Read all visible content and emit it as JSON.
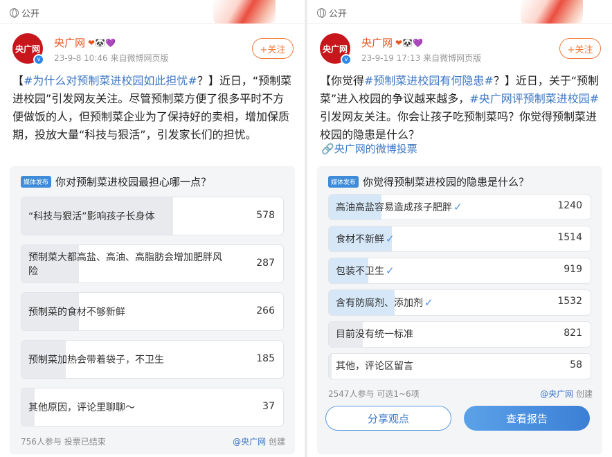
{
  "left": {
    "visibility": "公开",
    "account": "央广网",
    "time": "23-9-8 10:46",
    "source": "来自微博网页版",
    "follow": "+关注",
    "avatar": "央广网",
    "post_tag": "#为什么对预制菜进校园如此担忧#",
    "post_pre": "【",
    "post_text": "？】近日，“预制菜进校园”引发网友关注。尽管预制菜方便了很多平时不方便做饭的人，但预制菜企业为了保持好的卖相，增加保质期，投放大量“科技与狠活”，引发家长们的担忧。",
    "poll": {
      "badge": "媒体发布",
      "question": "你对预制菜进校园最担心哪一点？",
      "options": [
        {
          "label": "“科技与狠活”影响孩子长身体",
          "count": 578
        },
        {
          "label": "预制菜大都高盐、高油、高脂肪会增加肥胖风险",
          "count": 287
        },
        {
          "label": "预制菜的食材不够新鲜",
          "count": 266
        },
        {
          "label": "预制菜加热会带着袋子，不卫生",
          "count": 185
        },
        {
          "label": "其他原因，评论里聊聊～",
          "count": 37
        }
      ],
      "footer_left": "756人参与  投票已结束",
      "footer_right_name": "@央广网",
      "footer_right_suffix": " 创建"
    }
  },
  "right": {
    "visibility": "公开",
    "account": "央广网",
    "time": "23-9-19 17:13",
    "source": "来自微博网页版",
    "follow": "+关注",
    "avatar": "央广网",
    "post_pre": "【你觉得",
    "post_tag1": "#预制菜进校园有何隐患#",
    "post_mid": "？】近日，关于“预制菜”进入校园的争议越来越多，",
    "post_tag2": "#央广网评预制菜进校园#",
    "post_end": "引发网友关注。你会让孩子吃预制菜吗？你觉得预制菜进校园的隐患是什么？",
    "link": "央广网的微博投票",
    "poll": {
      "badge": "媒体发布",
      "question": "你觉得预制菜进校园的隐患是什么？",
      "options": [
        {
          "label": "高油高盐容易造成孩子肥胖",
          "count": 1240,
          "selected": true
        },
        {
          "label": "食材不新鲜",
          "count": 1514,
          "selected": true
        },
        {
          "label": "包装不卫生",
          "count": 919,
          "selected": true
        },
        {
          "label": "含有防腐剂、添加剂",
          "count": 1532,
          "selected": true
        },
        {
          "label": "目前没有统一标准",
          "count": 821,
          "selected": false
        },
        {
          "label": "其他，评论区留言",
          "count": 58,
          "selected": false
        }
      ],
      "footer_left": "2547人参与  可选1~6项",
      "footer_right_name": "@央广网",
      "footer_right_suffix": " 创建",
      "share": "分享观点",
      "report": "查看报告"
    }
  }
}
